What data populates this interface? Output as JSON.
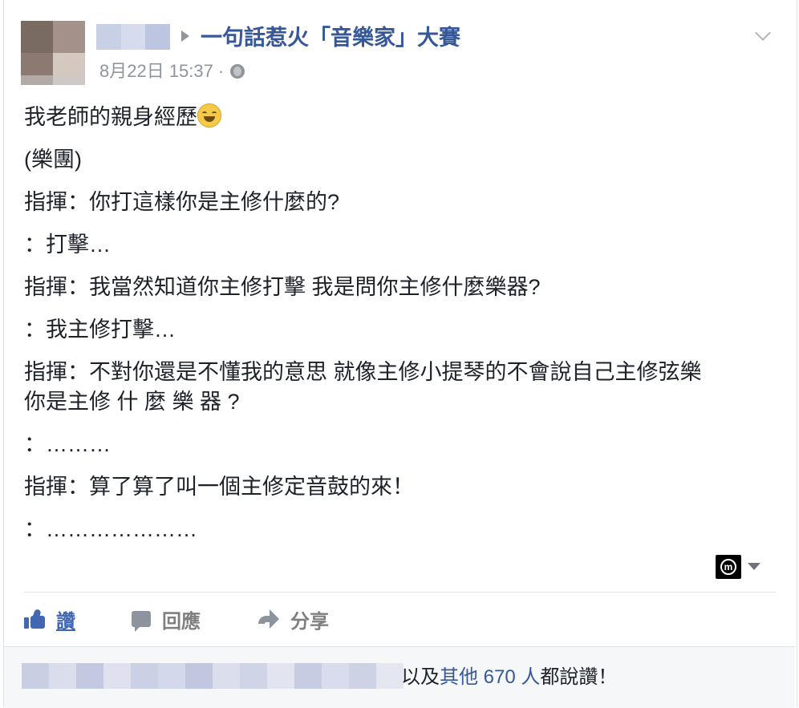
{
  "post": {
    "group_name": "一句話惹火「音樂家」大賽",
    "timestamp": "8月22日 15:37",
    "separator": "·",
    "privacy_icon": "globe-icon",
    "lines": [
      "我老師的親身經歷",
      "(樂團)",
      "指揮：你打這樣你是主修什麼的?",
      "：打擊…",
      "指揮：我當然知道你主修打擊 我是問你主修什麼樂器?",
      "：我主修打擊…",
      "指揮：不對你還是不懂我的意思 就像主修小提琴的不會說自己主修弦樂\n你是主修 什 麼 樂 器 ?",
      "：………",
      "指揮：算了算了叫一個主修定音鼓的來！",
      "：…………………"
    ],
    "emoji": "face-with-tears-of-joy-icon"
  },
  "actions": {
    "like_label": "讚",
    "comment_label": "回應",
    "share_label": "分享"
  },
  "likes": {
    "prefix": "以及",
    "others": "其他 670 人",
    "suffix": "都說讚！"
  },
  "colors": {
    "link": "#365899",
    "like_active": "#4267b2",
    "muted": "#90949c",
    "text": "#1d2129"
  }
}
